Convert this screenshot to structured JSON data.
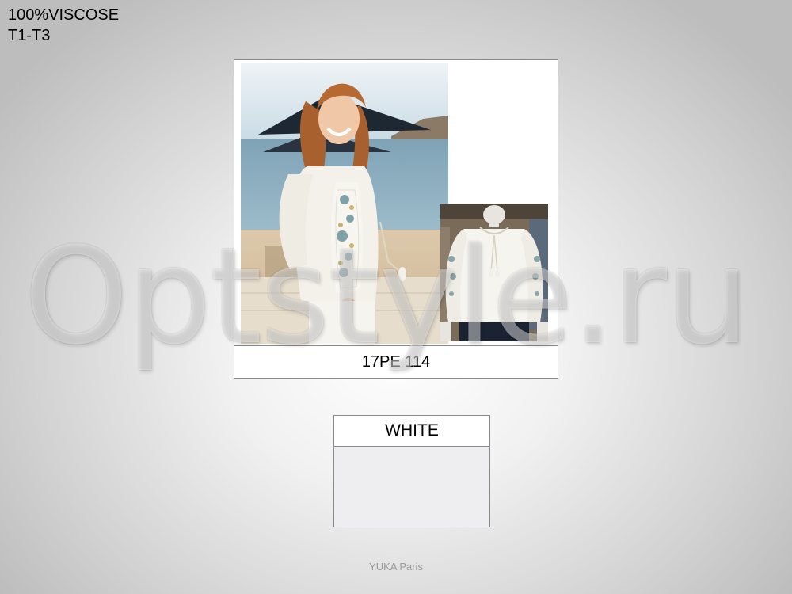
{
  "spec": {
    "material": "100%VISCOSE",
    "sizes": "T1-T3"
  },
  "watermark": "Optstyle.ru",
  "product": {
    "code": "17PE 114"
  },
  "color": {
    "name": "WHITE",
    "swatch": "#eeeef0"
  },
  "brand": "YUKA Paris"
}
